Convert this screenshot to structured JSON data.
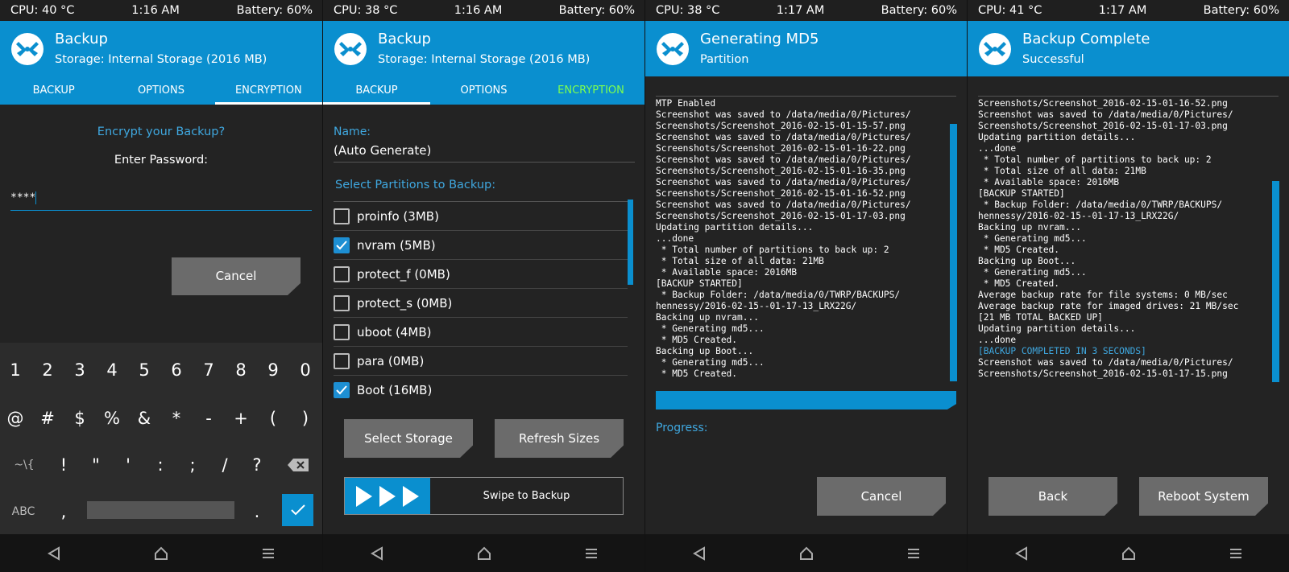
{
  "colors": {
    "accent": "#0a8fcf",
    "accent_text": "#3fa8e0",
    "active_tab_green": "#7dff4f",
    "background": "#232323",
    "button": "#6b6b6b"
  },
  "screens": [
    {
      "status": {
        "cpu": "CPU: 40 °C",
        "time": "1:16 AM",
        "battery": "Battery: 60%"
      },
      "header": {
        "title": "Backup",
        "subtitle": "Storage: Internal Storage (2016 MB)"
      },
      "tabs": [
        "BACKUP",
        "OPTIONS",
        "ENCRYPTION"
      ],
      "active_tab": "ENCRYPTION",
      "question": "Encrypt your Backup?",
      "password_label": "Enter Password:",
      "password_value": "****",
      "cancel_button": "Cancel",
      "keyboard": {
        "row1": [
          "1",
          "2",
          "3",
          "4",
          "5",
          "6",
          "7",
          "8",
          "9",
          "0"
        ],
        "row2": [
          "@",
          "#",
          "$",
          "%",
          "&",
          "*",
          "-",
          "+",
          "(",
          ")"
        ],
        "row3": [
          "~\\{",
          "!",
          "\"",
          "'",
          ":",
          ";",
          "/",
          "?"
        ],
        "row4": [
          "ABC",
          ",",
          "."
        ],
        "icons": [
          "backspace-icon",
          "checkmark-icon"
        ]
      }
    },
    {
      "status": {
        "cpu": "CPU: 38 °C",
        "time": "1:16 AM",
        "battery": "Battery: 60%"
      },
      "header": {
        "title": "Backup",
        "subtitle": "Storage: Internal Storage (2016 MB)"
      },
      "tabs": [
        "BACKUP",
        "OPTIONS",
        "ENCRYPTION"
      ],
      "active_tab": "BACKUP",
      "name_label": "Name:",
      "name_value": "(Auto Generate)",
      "select_label": "Select Partitions to Backup:",
      "partitions": [
        {
          "label": "proinfo (3MB)",
          "checked": false
        },
        {
          "label": "nvram (5MB)",
          "checked": true
        },
        {
          "label": "protect_f (0MB)",
          "checked": false
        },
        {
          "label": "protect_s (0MB)",
          "checked": false
        },
        {
          "label": "uboot (4MB)",
          "checked": false
        },
        {
          "label": "para (0MB)",
          "checked": false
        },
        {
          "label": "Boot (16MB)",
          "checked": true
        }
      ],
      "select_storage_button": "Select Storage",
      "refresh_sizes_button": "Refresh Sizes",
      "swipe_label": "Swipe to Backup"
    },
    {
      "status": {
        "cpu": "CPU: 38 °C",
        "time": "1:17 AM",
        "battery": "Battery: 60%"
      },
      "header": {
        "title": "Generating MD5",
        "subtitle": "Partition"
      },
      "console_lines": [
        "MTP Enabled",
        "Screenshot was saved to /data/media/0/Pictures/",
        "Screenshots/Screenshot_2016-02-15-01-15-57.png",
        "Screenshot was saved to /data/media/0/Pictures/",
        "Screenshots/Screenshot_2016-02-15-01-16-22.png",
        "Screenshot was saved to /data/media/0/Pictures/",
        "Screenshots/Screenshot_2016-02-15-01-16-35.png",
        "Screenshot was saved to /data/media/0/Pictures/",
        "Screenshots/Screenshot_2016-02-15-01-16-52.png",
        "Screenshot was saved to /data/media/0/Pictures/",
        "Screenshots/Screenshot_2016-02-15-01-17-03.png",
        "Updating partition details...",
        "...done",
        " * Total number of partitions to back up: 2",
        " * Total size of all data: 21MB",
        " * Available space: 2016MB",
        "[BACKUP STARTED]",
        " * Backup Folder: /data/media/0/TWRP/BACKUPS/",
        "hennessy/2016-02-15--01-17-13_LRX22G/",
        "Backing up nvram...",
        " * Generating md5...",
        " * MD5 Created.",
        "Backing up Boot...",
        " * Generating md5...",
        " * MD5 Created."
      ],
      "progress_label": "Progress:",
      "progress_fraction": 1.0,
      "cancel_button": "Cancel"
    },
    {
      "status": {
        "cpu": "CPU: 41 °C",
        "time": "1:17 AM",
        "battery": "Battery: 60%"
      },
      "header": {
        "title": "Backup Complete",
        "subtitle": "Successful"
      },
      "console_lines": [
        "Screenshots/Screenshot_2016-02-15-01-16-52.png",
        "Screenshot was saved to /data/media/0/Pictures/",
        "Screenshots/Screenshot_2016-02-15-01-17-03.png",
        "Updating partition details...",
        "...done",
        " * Total number of partitions to back up: 2",
        " * Total size of all data: 21MB",
        " * Available space: 2016MB",
        "[BACKUP STARTED]",
        " * Backup Folder: /data/media/0/TWRP/BACKUPS/",
        "hennessy/2016-02-15--01-17-13_LRX22G/",
        "Backing up nvram...",
        " * Generating md5...",
        " * MD5 Created.",
        "Backing up Boot...",
        " * Generating md5...",
        " * MD5 Created.",
        "Average backup rate for file systems: 0 MB/sec",
        "Average backup rate for imaged drives: 21 MB/sec",
        "[21 MB TOTAL BACKED UP]",
        "Updating partition details...",
        "...done",
        "[BACKUP COMPLETED IN 3 SECONDS]",
        "Screenshot was saved to /data/media/0/Pictures/",
        "Screenshots/Screenshot_2016-02-15-01-17-15.png"
      ],
      "highlight_line": "[BACKUP COMPLETED IN 3 SECONDS]",
      "back_button": "Back",
      "reboot_button": "Reboot System"
    }
  ],
  "navbar_icons": [
    "back-triangle-icon",
    "home-icon",
    "menu-icon"
  ]
}
